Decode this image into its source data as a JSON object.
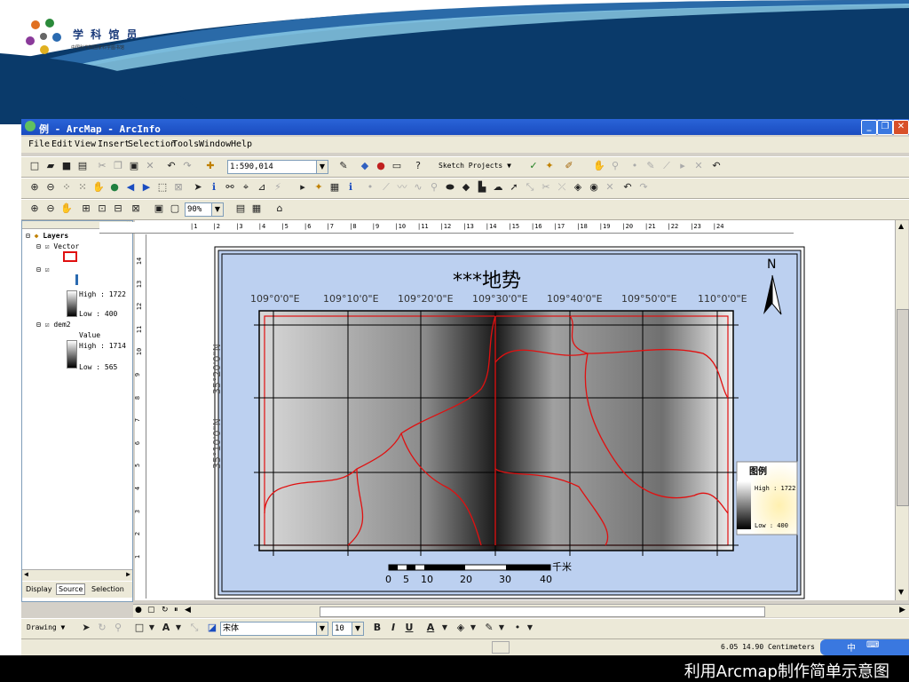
{
  "slide": {
    "logo_text": "学 科 馆 员",
    "logo_subtext": "中国科学院国家科学图书馆",
    "caption": "利用Arcmap制作简单示意图"
  },
  "window": {
    "title": "例 - ArcMap - ArcInfo"
  },
  "menu": [
    "File",
    "Edit",
    "View",
    "Insert",
    "Selection",
    "Tools",
    "Window",
    "Help"
  ],
  "toolbar": {
    "scale_value": "1:590,014",
    "sketch_label": "Sketch Projects ▼",
    "zoom_value": "90%",
    "drawing_label": "Drawing ▼",
    "font_name": "宋体",
    "font_size": "10",
    "bold": "B",
    "italic": "I",
    "underline": "U",
    "text_tool": "A"
  },
  "toc": {
    "root": "Layers",
    "vector": "Vector",
    "high1": "High : 1722",
    "low1": "Low : 400",
    "dem2": "dem2",
    "value": "Value",
    "high2": "High : 1714",
    "low2": "Low : 565",
    "tabs": [
      "Display",
      "Source",
      "Selection"
    ]
  },
  "map": {
    "title": "***地势",
    "north": "N",
    "lon_labels": [
      "109°0'0\"E",
      "109°10'0\"E",
      "109°20'0\"E",
      "109°30'0\"E",
      "109°40'0\"E",
      "109°50'0\"E",
      "110°0'0\"E"
    ],
    "lat_labels": [
      "35°20'0\"N",
      "35°10'0\"N"
    ],
    "legend_title": "图例",
    "legend_high": "High : 1722",
    "legend_low": "Low : 400",
    "scale_ticks": [
      "0",
      "5",
      "10",
      "20",
      "30",
      "40"
    ],
    "scale_unit": "千米"
  },
  "ruler": {
    "h": [
      "1",
      "2",
      "3",
      "4",
      "5",
      "6",
      "7",
      "8",
      "9",
      "10",
      "11",
      "12",
      "13",
      "14",
      "15",
      "16",
      "17",
      "18",
      "19",
      "20",
      "21",
      "22",
      "23",
      "24"
    ],
    "v": [
      "14",
      "13",
      "12",
      "11",
      "10",
      "9",
      "8",
      "7",
      "6",
      "5",
      "4",
      "3",
      "2",
      "1"
    ]
  },
  "status": {
    "coords": "6.05  14.90 Centimeters"
  },
  "colors": {
    "map_bg": "#bcd0f0",
    "boundary": "#e01010",
    "title_blue": "#1a4cc0"
  }
}
